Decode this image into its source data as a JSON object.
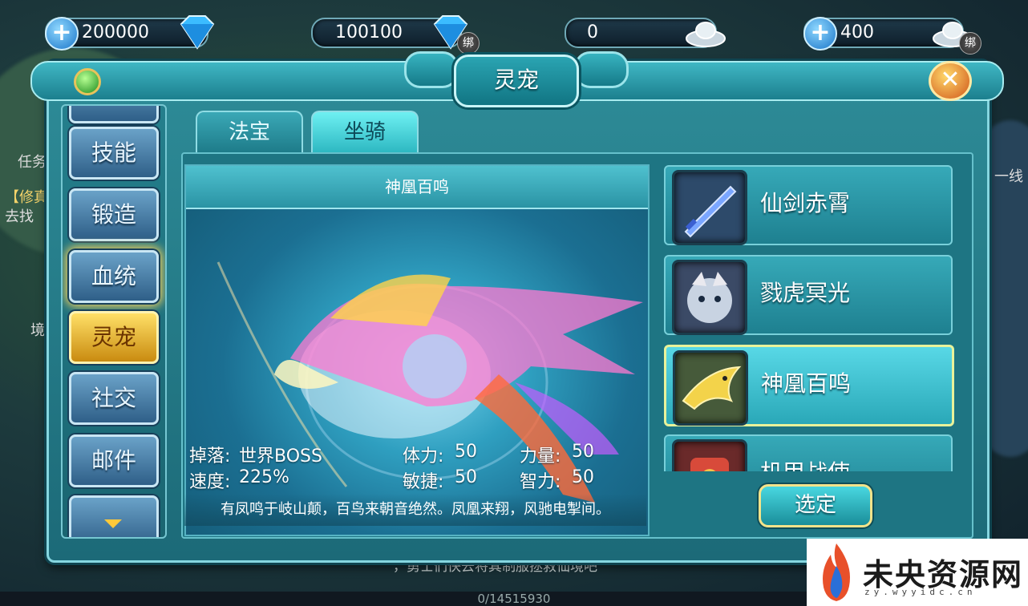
{
  "currencies": [
    {
      "value": "200000",
      "has_plus": true,
      "gem": "diamond-icon",
      "bind": ""
    },
    {
      "value": "100100",
      "has_plus": false,
      "gem": "diamond-icon",
      "bind": "绑"
    },
    {
      "value": "0",
      "has_plus": false,
      "gem": "silver-ingot-icon",
      "bind": ""
    },
    {
      "value": "400",
      "has_plus": true,
      "gem": "silver-ingot-icon",
      "bind": "绑"
    }
  ],
  "window": {
    "title": "灵宠"
  },
  "nav": {
    "items": [
      {
        "label": "技能",
        "state": "normal"
      },
      {
        "label": "锻造",
        "state": "normal"
      },
      {
        "label": "血统",
        "state": "glow"
      },
      {
        "label": "灵宠",
        "state": "active"
      },
      {
        "label": "社交",
        "state": "normal"
      },
      {
        "label": "邮件",
        "state": "normal"
      }
    ]
  },
  "tabs": [
    {
      "label": "法宝",
      "active": false
    },
    {
      "label": "坐骑",
      "active": true
    }
  ],
  "preview": {
    "name": "神凰百鸣",
    "stats": {
      "drop_label": "掉落:",
      "drop_value": "世界BOSS",
      "speed_label": "速度:",
      "speed_value": "225%",
      "stamina_label": "体力:",
      "stamina_value": "50",
      "agility_label": "敏捷:",
      "agility_value": "50",
      "strength_label": "力量:",
      "strength_value": "50",
      "intellect_label": "智力:",
      "intellect_value": "50"
    },
    "description": "有凤鸣于岐山颠，百鸟来朝音绝然。凤凰来翔，风驰电掣间。"
  },
  "mounts": [
    {
      "name": "仙剑赤霄",
      "icon": "sword-icon",
      "selected": false
    },
    {
      "name": "戮虎冥光",
      "icon": "tiger-icon",
      "selected": false
    },
    {
      "name": "神凰百鸣",
      "icon": "phoenix-icon",
      "selected": true
    },
    {
      "name": "机甲战使",
      "icon": "mech-icon",
      "selected": false
    }
  ],
  "select_button": "选定",
  "bottom_bar": {
    "progress_text": "0/14515930"
  },
  "background_text": {
    "left_task": "任务",
    "left_quest": "【修真",
    "left_goto": "去找",
    "left_realm": "境",
    "right_line": "一线",
    "bottom_msg": "，勇士们快去将其制服拯救仙境吧"
  },
  "watermark": {
    "text": "未央资源网",
    "url": "zy.wyyidc.cn"
  }
}
